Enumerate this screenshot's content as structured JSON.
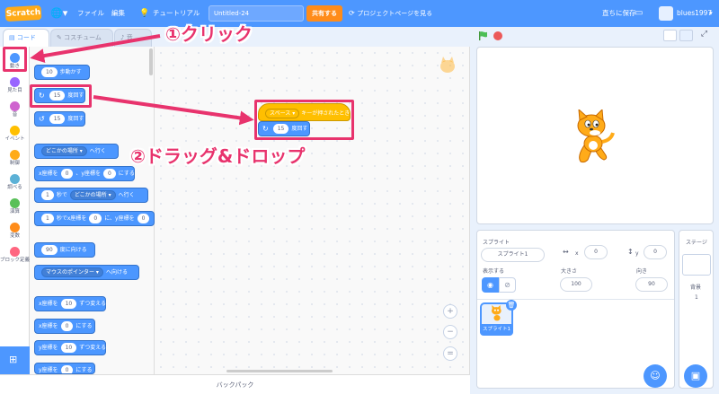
{
  "menubar": {
    "logo": "Scratch",
    "file": "ファイル",
    "edit": "編集",
    "tutorial": "チュートリアル",
    "project_title": "Untitled-24",
    "share": "共有する",
    "project_page": "プロジェクトページを見る",
    "save_now": "直ちに保存",
    "username": "blues1997"
  },
  "tabs": {
    "code": "コード",
    "costume": "コスチューム",
    "sound": "音"
  },
  "categories": [
    {
      "label": "動き",
      "color": "#4c97ff"
    },
    {
      "label": "見た目",
      "color": "#9966ff"
    },
    {
      "label": "音",
      "color": "#cf63cf"
    },
    {
      "label": "イベント",
      "color": "#ffbf00"
    },
    {
      "label": "制御",
      "color": "#ffab19"
    },
    {
      "label": "調べる",
      "color": "#5cb1d6"
    },
    {
      "label": "演算",
      "color": "#59c059"
    },
    {
      "label": "変数",
      "color": "#ff8c1a"
    },
    {
      "label": "ブロック定義",
      "color": "#ff6680"
    }
  ],
  "blocks": {
    "move": {
      "value": "10",
      "text": "歩動かす"
    },
    "turn_right": {
      "value": "15",
      "text": "度回す"
    },
    "turn_left": {
      "value": "15",
      "text": "度回す"
    },
    "goto": {
      "dropdown": "どこかの場所",
      "text": "へ行く"
    },
    "goto_xy": {
      "a": "x座標を",
      "x": "0",
      "b": "、y座標を",
      "y": "0",
      "c": "にする"
    },
    "glide": {
      "sec": "1",
      "a": "秒で",
      "dropdown": "どこかの場所",
      "b": "へ行く"
    },
    "glide_xy": {
      "sec": "1",
      "a": "秒でx座標を",
      "x": "0",
      "b": "に、y座標を",
      "y": "0"
    },
    "point_dir": {
      "value": "90",
      "text": "度に向ける"
    },
    "point_towards": {
      "dropdown": "マウスのポインター",
      "text": "へ向ける"
    },
    "change_x": {
      "a": "x座標を",
      "value": "10",
      "b": "ずつ変える"
    },
    "set_x": {
      "a": "x座標を",
      "value": "0",
      "b": "にする"
    },
    "change_y": {
      "a": "y座標を",
      "value": "10",
      "b": "ずつ変える"
    },
    "set_y": {
      "a": "y座標を",
      "value": "0",
      "b": "にする"
    }
  },
  "script": {
    "hat_dropdown": "スペース",
    "hat_text": "キーが押されたとき",
    "turn_value": "15",
    "turn_text": "度回す"
  },
  "backpack": "バックパック",
  "sprite_info": {
    "sprite_label": "スプライト",
    "sprite_name": "スプライト1",
    "x_label": "x",
    "x": "0",
    "y_label": "y",
    "y": "0",
    "show_label": "表示する",
    "size_label": "大きさ",
    "size": "100",
    "direction_label": "向き",
    "direction": "90",
    "thumb_name": "スプライト1"
  },
  "stage_panel": {
    "title": "ステージ",
    "backdrop_label": "背景",
    "backdrop_count": "1"
  },
  "annotations": {
    "click": "①クリック",
    "drag": "②ドラッグ&ドロップ"
  },
  "colors": {
    "annotation": "#e8336d",
    "menubar": "#4d97ff",
    "motion": "#4c97ff",
    "events": "#ffbf00"
  }
}
